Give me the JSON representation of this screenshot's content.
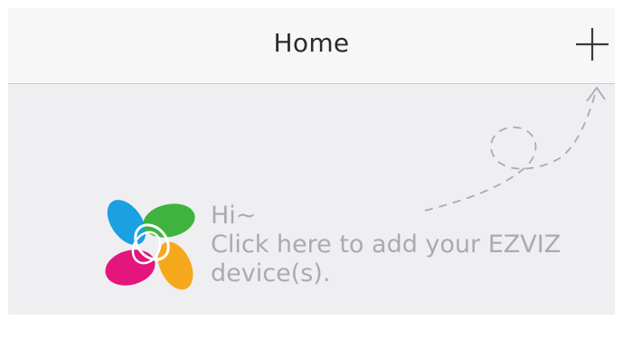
{
  "header": {
    "title": "Home",
    "add_icon": "plus-icon"
  },
  "empty_state": {
    "greeting": "Hi~",
    "line1": "Click here to add your EZVIZ",
    "line2": "device(s).",
    "logo": "ezviz-logo",
    "pointer_icon": "dashed-arrow-icon"
  },
  "colors": {
    "header_bg": "#f7f7f8",
    "body_bg": "#efeff1",
    "hint_text": "#a9abb2",
    "logo_blue": "#1ba0e2",
    "logo_green": "#3eb43e",
    "logo_magenta": "#e4157c",
    "logo_orange": "#f6a81c"
  }
}
